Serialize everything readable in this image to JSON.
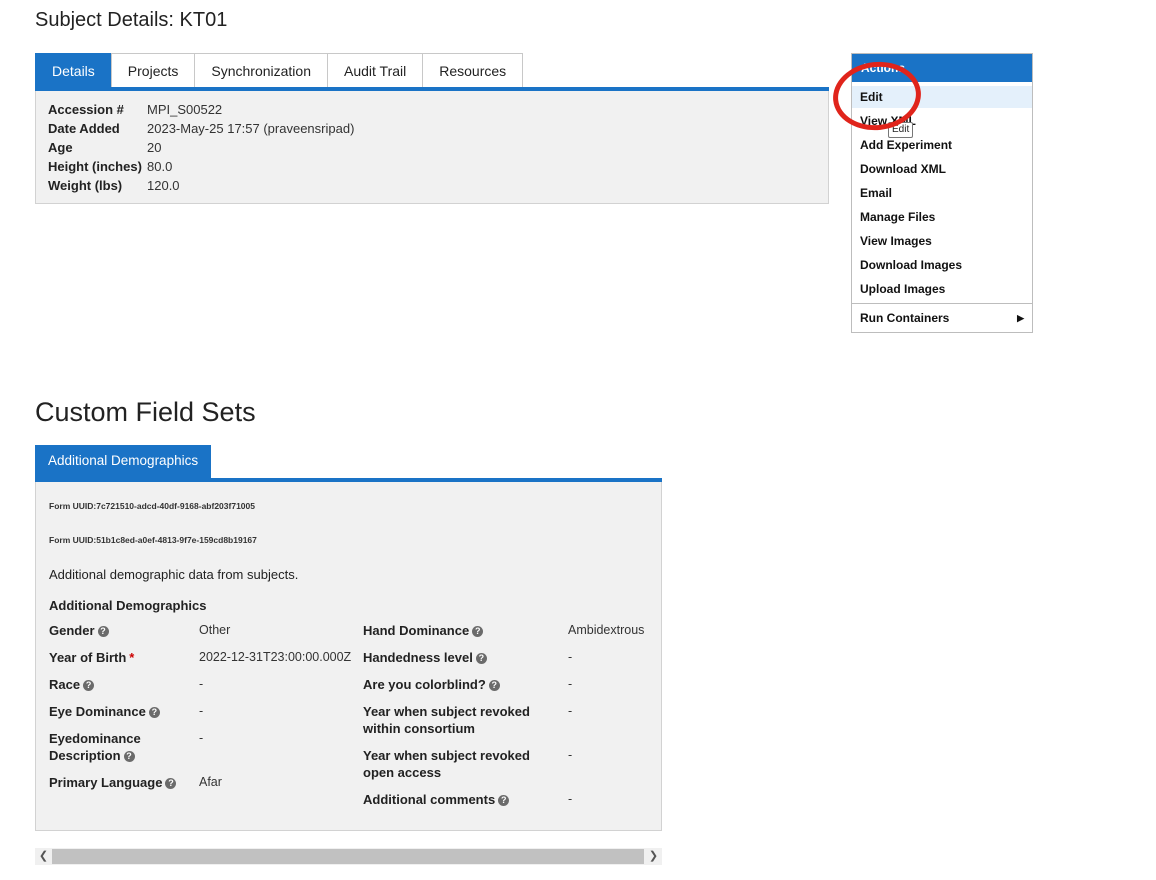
{
  "page": {
    "title": "Subject Details: KT01"
  },
  "tabs": [
    "Details",
    "Projects",
    "Synchronization",
    "Audit Trail",
    "Resources"
  ],
  "details": [
    {
      "key": "Accession #",
      "value": "MPI_S00522"
    },
    {
      "key": "Date Added",
      "value": "2023-May-25 17:57 (praveensripad)"
    },
    {
      "key": "Age",
      "value": "20"
    },
    {
      "key": "Height (inches)",
      "value": "80.0"
    },
    {
      "key": "Weight (lbs)",
      "value": "120.0"
    }
  ],
  "actions": {
    "header": "Actions",
    "items": [
      "Edit",
      "View XML",
      "Add Experiment",
      "Download XML",
      "Email",
      "Manage Files",
      "View Images",
      "Download Images",
      "Upload Images"
    ],
    "submenu": "Run Containers",
    "tooltip": "Edit"
  },
  "custom": {
    "title": "Custom Field Sets",
    "tab": "Additional Demographics",
    "uuid1": "Form UUID:7c721510-adcd-40df-9168-abf203f71005",
    "uuid2": "Form UUID:51b1c8ed-a0ef-4813-9f7e-159cd8b19167",
    "description": "Additional demographic data from subjects.",
    "section": "Additional Demographics",
    "left": [
      {
        "label": "Gender",
        "value": "Other"
      },
      {
        "label": "Year of Birth",
        "value": "2022-12-31T23:00:00.000Z"
      },
      {
        "label": "Race",
        "value": "-"
      },
      {
        "label": "Eye Dominance",
        "value": "-"
      },
      {
        "label": "Eyedominance Description",
        "value": "-"
      },
      {
        "label": "Primary Language",
        "value": "Afar"
      }
    ],
    "right": [
      {
        "label": "Hand Dominance",
        "value": "Ambidextrous"
      },
      {
        "label": "Handedness level",
        "value": "-"
      },
      {
        "label": "Are you colorblind?",
        "value": "-"
      },
      {
        "label": "Year when subject revoked within consortium",
        "value": "-"
      },
      {
        "label": "Year when subject revoked open access",
        "value": "-"
      },
      {
        "label": "Additional comments",
        "value": "-"
      }
    ]
  },
  "colors": {
    "accent": "#1a73c6",
    "annotation": "#e0241b"
  }
}
